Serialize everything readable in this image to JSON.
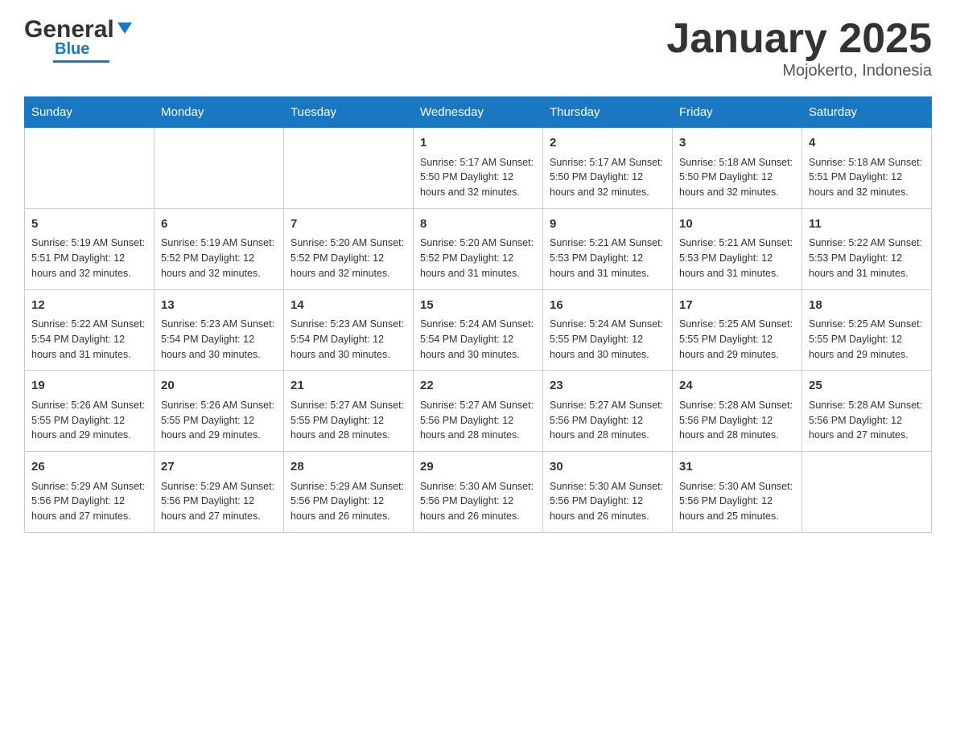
{
  "header": {
    "logo_general": "General",
    "logo_blue": "Blue",
    "month_title": "January 2025",
    "location": "Mojokerto, Indonesia"
  },
  "days_of_week": [
    "Sunday",
    "Monday",
    "Tuesday",
    "Wednesday",
    "Thursday",
    "Friday",
    "Saturday"
  ],
  "weeks": [
    {
      "days": [
        {
          "num": "",
          "info": ""
        },
        {
          "num": "",
          "info": ""
        },
        {
          "num": "",
          "info": ""
        },
        {
          "num": "1",
          "info": "Sunrise: 5:17 AM\nSunset: 5:50 PM\nDaylight: 12 hours\nand 32 minutes."
        },
        {
          "num": "2",
          "info": "Sunrise: 5:17 AM\nSunset: 5:50 PM\nDaylight: 12 hours\nand 32 minutes."
        },
        {
          "num": "3",
          "info": "Sunrise: 5:18 AM\nSunset: 5:50 PM\nDaylight: 12 hours\nand 32 minutes."
        },
        {
          "num": "4",
          "info": "Sunrise: 5:18 AM\nSunset: 5:51 PM\nDaylight: 12 hours\nand 32 minutes."
        }
      ]
    },
    {
      "days": [
        {
          "num": "5",
          "info": "Sunrise: 5:19 AM\nSunset: 5:51 PM\nDaylight: 12 hours\nand 32 minutes."
        },
        {
          "num": "6",
          "info": "Sunrise: 5:19 AM\nSunset: 5:52 PM\nDaylight: 12 hours\nand 32 minutes."
        },
        {
          "num": "7",
          "info": "Sunrise: 5:20 AM\nSunset: 5:52 PM\nDaylight: 12 hours\nand 32 minutes."
        },
        {
          "num": "8",
          "info": "Sunrise: 5:20 AM\nSunset: 5:52 PM\nDaylight: 12 hours\nand 31 minutes."
        },
        {
          "num": "9",
          "info": "Sunrise: 5:21 AM\nSunset: 5:53 PM\nDaylight: 12 hours\nand 31 minutes."
        },
        {
          "num": "10",
          "info": "Sunrise: 5:21 AM\nSunset: 5:53 PM\nDaylight: 12 hours\nand 31 minutes."
        },
        {
          "num": "11",
          "info": "Sunrise: 5:22 AM\nSunset: 5:53 PM\nDaylight: 12 hours\nand 31 minutes."
        }
      ]
    },
    {
      "days": [
        {
          "num": "12",
          "info": "Sunrise: 5:22 AM\nSunset: 5:54 PM\nDaylight: 12 hours\nand 31 minutes."
        },
        {
          "num": "13",
          "info": "Sunrise: 5:23 AM\nSunset: 5:54 PM\nDaylight: 12 hours\nand 30 minutes."
        },
        {
          "num": "14",
          "info": "Sunrise: 5:23 AM\nSunset: 5:54 PM\nDaylight: 12 hours\nand 30 minutes."
        },
        {
          "num": "15",
          "info": "Sunrise: 5:24 AM\nSunset: 5:54 PM\nDaylight: 12 hours\nand 30 minutes."
        },
        {
          "num": "16",
          "info": "Sunrise: 5:24 AM\nSunset: 5:55 PM\nDaylight: 12 hours\nand 30 minutes."
        },
        {
          "num": "17",
          "info": "Sunrise: 5:25 AM\nSunset: 5:55 PM\nDaylight: 12 hours\nand 29 minutes."
        },
        {
          "num": "18",
          "info": "Sunrise: 5:25 AM\nSunset: 5:55 PM\nDaylight: 12 hours\nand 29 minutes."
        }
      ]
    },
    {
      "days": [
        {
          "num": "19",
          "info": "Sunrise: 5:26 AM\nSunset: 5:55 PM\nDaylight: 12 hours\nand 29 minutes."
        },
        {
          "num": "20",
          "info": "Sunrise: 5:26 AM\nSunset: 5:55 PM\nDaylight: 12 hours\nand 29 minutes."
        },
        {
          "num": "21",
          "info": "Sunrise: 5:27 AM\nSunset: 5:55 PM\nDaylight: 12 hours\nand 28 minutes."
        },
        {
          "num": "22",
          "info": "Sunrise: 5:27 AM\nSunset: 5:56 PM\nDaylight: 12 hours\nand 28 minutes."
        },
        {
          "num": "23",
          "info": "Sunrise: 5:27 AM\nSunset: 5:56 PM\nDaylight: 12 hours\nand 28 minutes."
        },
        {
          "num": "24",
          "info": "Sunrise: 5:28 AM\nSunset: 5:56 PM\nDaylight: 12 hours\nand 28 minutes."
        },
        {
          "num": "25",
          "info": "Sunrise: 5:28 AM\nSunset: 5:56 PM\nDaylight: 12 hours\nand 27 minutes."
        }
      ]
    },
    {
      "days": [
        {
          "num": "26",
          "info": "Sunrise: 5:29 AM\nSunset: 5:56 PM\nDaylight: 12 hours\nand 27 minutes."
        },
        {
          "num": "27",
          "info": "Sunrise: 5:29 AM\nSunset: 5:56 PM\nDaylight: 12 hours\nand 27 minutes."
        },
        {
          "num": "28",
          "info": "Sunrise: 5:29 AM\nSunset: 5:56 PM\nDaylight: 12 hours\nand 26 minutes."
        },
        {
          "num": "29",
          "info": "Sunrise: 5:30 AM\nSunset: 5:56 PM\nDaylight: 12 hours\nand 26 minutes."
        },
        {
          "num": "30",
          "info": "Sunrise: 5:30 AM\nSunset: 5:56 PM\nDaylight: 12 hours\nand 26 minutes."
        },
        {
          "num": "31",
          "info": "Sunrise: 5:30 AM\nSunset: 5:56 PM\nDaylight: 12 hours\nand 25 minutes."
        },
        {
          "num": "",
          "info": ""
        }
      ]
    }
  ]
}
